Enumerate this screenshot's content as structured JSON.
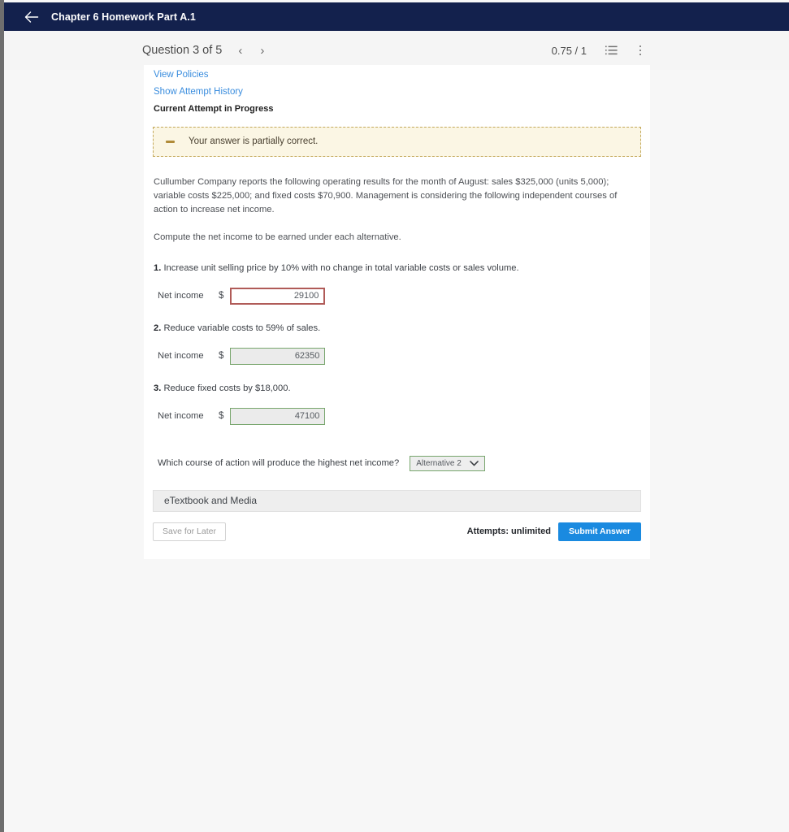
{
  "header": {
    "back_icon": "back-arrow-icon",
    "title": "Chapter 6 Homework Part A.1",
    "background_color": "#13214d"
  },
  "toolbar": {
    "question_counter": "Question 3 of 5",
    "prev_label": "‹",
    "next_label": "›",
    "score": "0.75 / 1",
    "list_icon": "list-icon",
    "menu_icon": "kebab-menu-icon"
  },
  "links": {
    "view_policies": "View Policies",
    "show_attempt_history": "Show Attempt History",
    "current_attempt": "Current Attempt in Progress"
  },
  "alert": {
    "icon": "partial-credit-dash-icon",
    "text": "Your answer is partially correct.",
    "background_color": "#fbf6e4",
    "border_color": "#c4a95b"
  },
  "problem": {
    "intro": "Cullumber Company reports the following operating results for the month of August: sales $325,000 (units 5,000); variable costs $225,000; and fixed costs $70,900. Management is considering the following independent courses of action to increase net income.",
    "instruction": "Compute the net income to be earned under each alternative."
  },
  "alternatives": [
    {
      "number": "1.",
      "text": "Increase unit selling price by 10% with no change in total variable costs or sales volume.",
      "answer_label": "Net income",
      "currency": "$",
      "value": "29100",
      "state": "incorrect"
    },
    {
      "number": "2.",
      "text": "Reduce variable costs to 59% of sales.",
      "answer_label": "Net income",
      "currency": "$",
      "value": "62350",
      "state": "correct"
    },
    {
      "number": "3.",
      "text": "Reduce fixed costs by $18,000.",
      "answer_label": "Net income",
      "currency": "$",
      "value": "47100",
      "state": "correct"
    }
  ],
  "dropdown": {
    "question": "Which course of action will produce the highest net income?",
    "selected": "Alternative 2",
    "chevron_icon": "chevron-down-icon"
  },
  "etextbook": {
    "label": "eTextbook and Media"
  },
  "footer": {
    "save_label": "Save for Later",
    "attempts": "Attempts: unlimited",
    "submit_label": "Submit Answer",
    "submit_color": "#1a8ae0"
  }
}
